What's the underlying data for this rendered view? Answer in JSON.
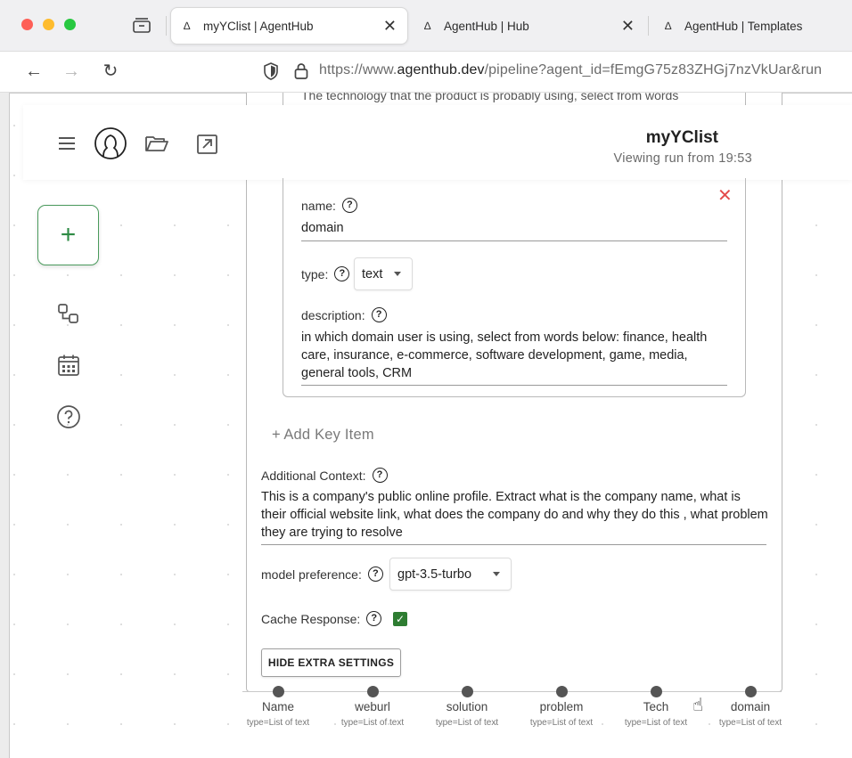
{
  "browser": {
    "tabs": [
      {
        "label": "myYClist | AgentHub",
        "active": true
      },
      {
        "label": "AgentHub | Hub",
        "active": false
      },
      {
        "label": "AgentHub | Templates",
        "active": false
      }
    ],
    "url_prefix": "https://www.",
    "url_domain": "agenthub.dev",
    "url_rest": "/pipeline?agent_id=fEmgG75z83ZHGj7nzVkUar&run"
  },
  "header": {
    "title": "myYClist",
    "subtitle": "Viewing run from 19:53"
  },
  "prev_card": {
    "description_clip": "The technology that the product is probably using, select from words"
  },
  "key_item": {
    "name_label": "name:",
    "name_value": "domain",
    "type_label": "type:",
    "type_value": "text",
    "description_label": "description:",
    "description_value": "in which domain user is using,   select from words below: finance, health care,  insurance, e-commerce,  software development, game, media, general tools,  CRM"
  },
  "add_key_label": "Add Key Item",
  "additional_context": {
    "label": "Additional Context:",
    "value": "This is a company's public online profile. Extract what is the company name, what is their official website link, what does the company do and why they do this , what problem they are trying to resolve"
  },
  "model_preference": {
    "label": "model preference:",
    "value": "gpt-3.5-turbo"
  },
  "cache_response": {
    "label": "Cache Response:",
    "checked": true
  },
  "hide_button_label": "HIDE EXTRA SETTINGS",
  "outputs": [
    {
      "name": "Name",
      "type": "type=List of text"
    },
    {
      "name": "weburl",
      "type": "type=List of text"
    },
    {
      "name": "solution",
      "type": "type=List of text"
    },
    {
      "name": "problem",
      "type": "type=List of text"
    },
    {
      "name": "Tech",
      "type": "type=List of text"
    },
    {
      "name": "domain",
      "type": "type=List of text"
    }
  ],
  "colors": {
    "accent_green": "#2e7d32",
    "delete_red": "#e44b4b"
  }
}
